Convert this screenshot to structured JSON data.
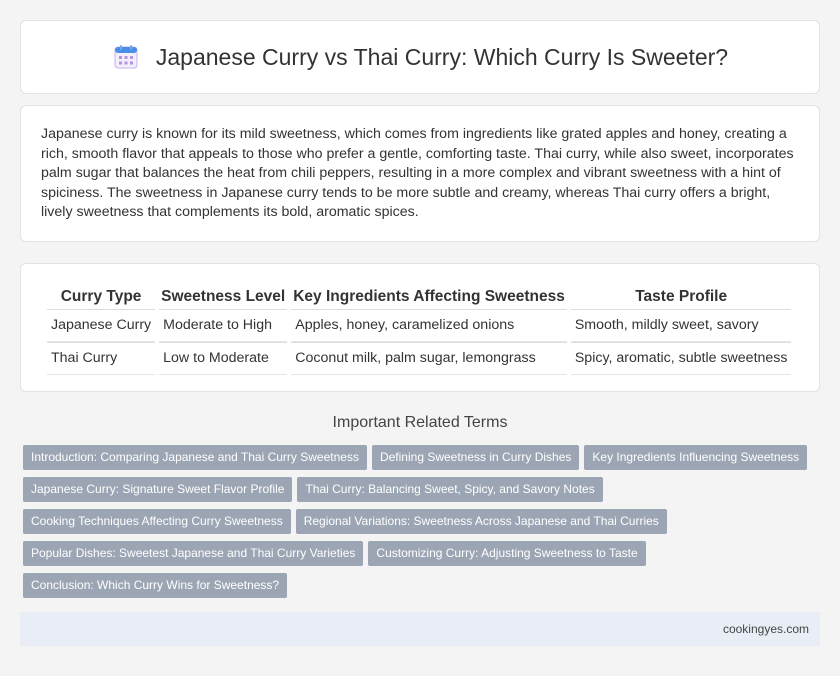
{
  "header": {
    "title": "Japanese Curry vs Thai Curry: Which Curry Is Sweeter?",
    "icon": "calendar-icon"
  },
  "intro": {
    "text": "Japanese curry is known for its mild sweetness, which comes from ingredients like grated apples and honey, creating a rich, smooth flavor that appeals to those who prefer a gentle, comforting taste. Thai curry, while also sweet, incorporates palm sugar that balances the heat from chili peppers, resulting in a more complex and vibrant sweetness with a hint of spiciness. The sweetness in Japanese curry tends to be more subtle and creamy, whereas Thai curry offers a bright, lively sweetness that complements its bold, aromatic spices."
  },
  "table": {
    "headers": [
      "Curry Type",
      "Sweetness Level",
      "Key Ingredients Affecting Sweetness",
      "Taste Profile"
    ],
    "rows": [
      [
        "Japanese Curry",
        "Moderate to High",
        "Apples, honey, caramelized onions",
        "Smooth, mildly sweet, savory"
      ],
      [
        "Thai Curry",
        "Low to Moderate",
        "Coconut milk, palm sugar, lemongrass",
        "Spicy, aromatic, subtle sweetness"
      ]
    ]
  },
  "related": {
    "title": "Important Related Terms",
    "tags": [
      "Introduction: Comparing Japanese and Thai Curry Sweetness",
      "Defining Sweetness in Curry Dishes",
      "Key Ingredients Influencing Sweetness",
      "Japanese Curry: Signature Sweet Flavor Profile",
      "Thai Curry: Balancing Sweet, Spicy, and Savory Notes",
      "Cooking Techniques Affecting Curry Sweetness",
      "Regional Variations: Sweetness Across Japanese and Thai Curries",
      "Popular Dishes: Sweetest Japanese and Thai Curry Varieties",
      "Customizing Curry: Adjusting Sweetness to Taste",
      "Conclusion: Which Curry Wins for Sweetness?"
    ]
  },
  "footer": {
    "site": "cookingyes.com"
  },
  "colors": {
    "tag_bg": "#9ba5b4",
    "footer_bg": "#e9eef6",
    "icon_accent": "#4a8fe7",
    "icon_grid": "#b592e6"
  }
}
